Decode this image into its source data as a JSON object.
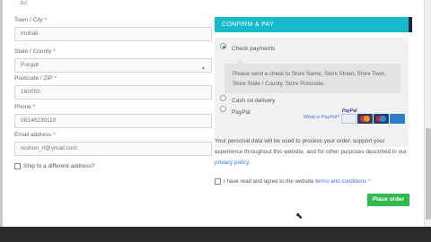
{
  "top_cut_text": "dst",
  "form": {
    "fields": [
      {
        "label": "Town / City",
        "required": "*",
        "value": "mohali"
      },
      {
        "label": "State / County",
        "required": "*",
        "value": "Punjab",
        "caret": "▼"
      },
      {
        "label": "Postcode / ZIP",
        "required": "*",
        "value": "160055"
      },
      {
        "label": "Phone",
        "required": "*",
        "value": "08146239110"
      },
      {
        "label": "Email address",
        "required": "*",
        "value": "reshon_rl@ymail.com"
      }
    ],
    "ship_label": "Ship to a different address?"
  },
  "panel": {
    "title": "CONFIRM & PAY",
    "check_payments_label": "Check payments",
    "check_note": "Please send a check to Store Name, Store Street, Store Town, Store State / County, Store Postcode.",
    "cod_label": "Cash on delivery",
    "paypal_label": "PayPal",
    "what_is_paypal": "What is PayPal?",
    "paypal_logo": "PayPal",
    "card_icons": [
      "paypal-card-icon",
      "mastercard-icon",
      "maestro-icon",
      "amex-icon"
    ]
  },
  "privacy": {
    "text": "Your personal data will be used to process your order, support your experience throughout this website, and for other purposes described in our",
    "link": "privacy policy",
    "end": "."
  },
  "terms": {
    "text": "I have read and agree to the website",
    "link": "terms and conditions",
    "required": "*"
  },
  "place_order_label": "Place order",
  "colors": {
    "accent": "#17b9cd",
    "button": "#2fbb4f",
    "link": "#3a77d8",
    "footer": "#2b2b2b"
  }
}
